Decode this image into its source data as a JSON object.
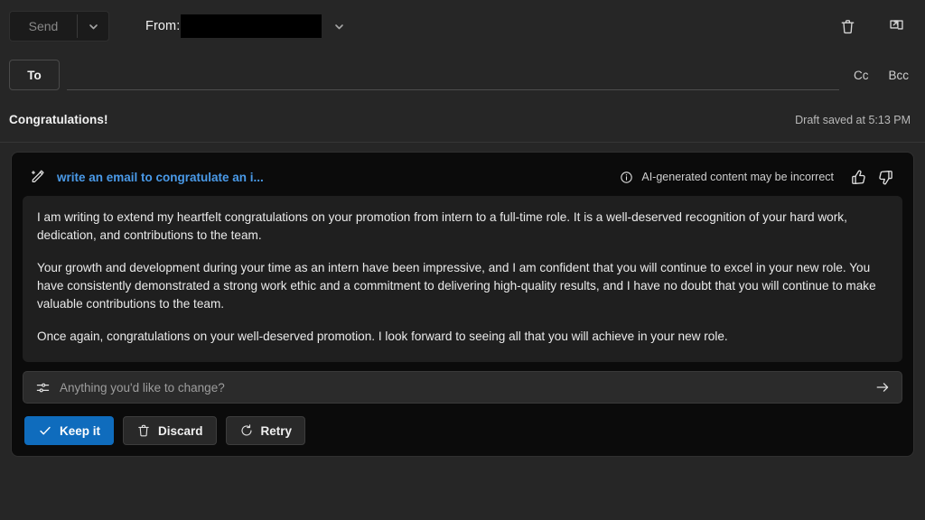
{
  "commandbar": {
    "send_label": "Send",
    "send_dropdown_icon": "chevron-down-icon",
    "from_label": "From:",
    "from_value_redacted": "",
    "from_dropdown_icon": "chevron-down-icon",
    "delete_icon": "trash-icon",
    "popout_icon": "pop-out-icon"
  },
  "recipients": {
    "to_label": "To",
    "to_value": "",
    "cc_label": "Cc",
    "bcc_label": "Bcc"
  },
  "subject": {
    "value": "Congratulations!",
    "draft_status": "Draft saved at 5:13 PM"
  },
  "copilot": {
    "pen_icon": "magic-pen-icon",
    "prompt": "write an email to congratulate an i...",
    "info_icon": "info-circle-icon",
    "disclaimer": "AI-generated content may be incorrect",
    "thumbs_up_icon": "thumbs-up-icon",
    "thumbs_down_icon": "thumbs-down-icon",
    "body_paragraphs": [
      "I am writing to extend my heartfelt congratulations on your promotion from intern to a full-time role. It is a well-deserved recognition of your hard work, dedication, and contributions to the team.",
      "Your growth and development during your time as an intern have been impressive, and I am confident that you will continue to excel in your new role. You have consistently demonstrated a strong work ethic and a commitment to delivering high-quality results, and I have no doubt that you will continue to make valuable contributions to the team.",
      "Once again, congratulations on your well-deserved promotion. I look forward to seeing all that you will achieve in your new role."
    ],
    "refine": {
      "sliders_icon": "sliders-icon",
      "placeholder": "Anything you'd like to change?",
      "value": "",
      "submit_icon": "arrow-right-icon"
    },
    "actions": {
      "keep_label": "Keep it",
      "keep_icon": "checkmark-icon",
      "discard_label": "Discard",
      "discard_icon": "trash-icon",
      "retry_label": "Retry",
      "retry_icon": "refresh-icon"
    }
  },
  "colors": {
    "accent": "#0f6cbd",
    "prompt_link": "#4a9ae8",
    "app_background": "#262626",
    "panel_background": "#0b0b0b",
    "body_background": "#1f1f1f"
  }
}
